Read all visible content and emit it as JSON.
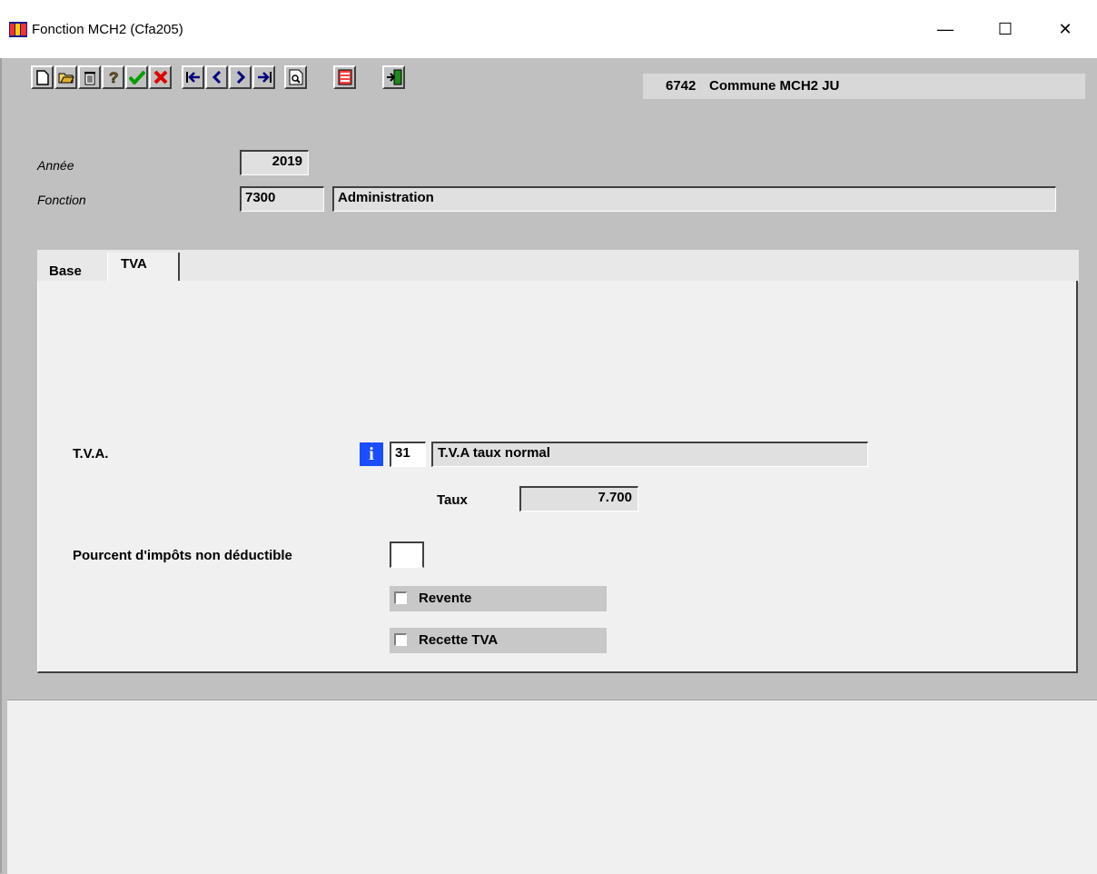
{
  "window": {
    "title": "Fonction MCH2 (Cfa205)",
    "controls": {
      "minimize": "—",
      "maximize": "☐",
      "close": "✕"
    }
  },
  "toolbar": {
    "buttons": [
      {
        "name": "new-icon"
      },
      {
        "name": "open-icon"
      },
      {
        "name": "delete-icon"
      },
      {
        "name": "help-icon"
      },
      {
        "name": "validate-icon"
      },
      {
        "name": "cancel-icon"
      },
      {
        "name": "first-record-icon"
      },
      {
        "name": "previous-record-icon"
      },
      {
        "name": "next-record-icon"
      },
      {
        "name": "last-record-icon"
      },
      {
        "name": "preview-icon"
      },
      {
        "name": "print-icon"
      },
      {
        "name": "exit-icon"
      }
    ]
  },
  "header": {
    "code": "6742",
    "name": "Commune MCH2 JU"
  },
  "form": {
    "annee_label": "Année",
    "annee_value": "2019",
    "fonction_label": "Fonction",
    "fonction_code": "7300",
    "fonction_name": "Administration"
  },
  "tabs": [
    {
      "label": "Base",
      "active": false
    },
    {
      "label": "TVA",
      "active": true
    }
  ],
  "tva": {
    "label": "T.V.A.",
    "info_glyph": "i",
    "code": "31",
    "name": "T.V.A taux normal",
    "taux_label": "Taux",
    "taux_value": "7.700",
    "pourcent_label": "Pourcent d'impôts non déductible",
    "pourcent_value": "",
    "revente_label": "Revente",
    "revente_checked": false,
    "recette_label": "Recette TVA",
    "recette_checked": false
  },
  "colors": {
    "accent_info": "#1a4dff",
    "validate": "#00a000",
    "cancel": "#e00000"
  }
}
